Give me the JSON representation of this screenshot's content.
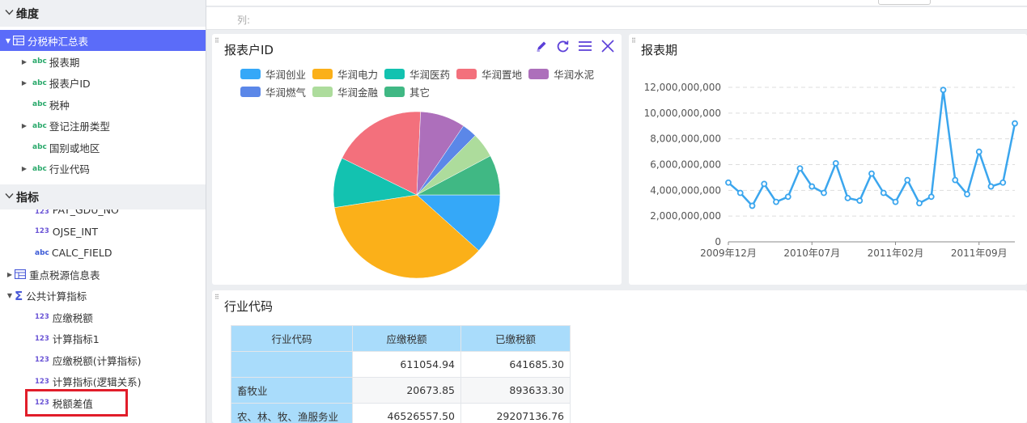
{
  "sidebar": {
    "dimensions_title": "维度",
    "table_name": "分税种汇总表",
    "dimension_fields": [
      {
        "label": "报表期",
        "expandable": true
      },
      {
        "label": "报表户ID",
        "expandable": true
      },
      {
        "label": "税种",
        "expandable": false
      },
      {
        "label": "登记注册类型",
        "expandable": true
      },
      {
        "label": "国别或地区",
        "expandable": false
      },
      {
        "label": "行业代码",
        "expandable": true
      }
    ],
    "metrics_title": "指标",
    "cut_field": "PAY_GDU_NO",
    "metric_fields_a": [
      "OJSE_INT",
      "CALC_FIELD"
    ],
    "table2_name": "重点税源信息表",
    "group_name": "公共计算指标",
    "calc_fields": [
      "应缴税额",
      "计算指标1",
      "应缴税额(计算指标)",
      "计算指标(逻辑关系)",
      "税额差值"
    ],
    "type_abc": "abc",
    "type_num": "123"
  },
  "colbar_label": "列:",
  "pie_panel": {
    "title": "报表户ID",
    "tools": [
      "edit-icon",
      "refresh-icon",
      "menu-icon",
      "close-icon"
    ]
  },
  "line_panel": {
    "title": "报表期"
  },
  "table_panel": {
    "title": "行业代码",
    "headers": [
      "行业代码",
      "应缴税额",
      "已缴税额"
    ],
    "rows": [
      [
        "",
        "611054.94",
        "641685.30"
      ],
      [
        "畜牧业",
        "20673.85",
        "893633.30"
      ],
      [
        "农、林、牧、渔服务业",
        "46526557.50",
        "29207136.76"
      ]
    ]
  },
  "chart_data": [
    {
      "type": "pie",
      "title": "报表户ID",
      "labels": [
        "华润创业",
        "华润电力",
        "华润医药",
        "华润置地",
        "华润水泥",
        "华润燃气",
        "华润金融",
        "其它"
      ],
      "colors": [
        "#35a8f8",
        "#fbb019",
        "#13c2b0",
        "#f3707c",
        "#ad6fbb",
        "#5b87e8",
        "#addc9c",
        "#40b884"
      ],
      "values": [
        12,
        37,
        10,
        19,
        9,
        3,
        5,
        8
      ]
    },
    {
      "type": "line",
      "title": "报表期",
      "color": "#3ba6ee",
      "y_ticks": [
        "0",
        "2,000,000,000",
        "4,000,000,000",
        "6,000,000,000",
        "8,000,000,000",
        "10,000,000,000",
        "12,000,000,000"
      ],
      "ylim": [
        0,
        12000000000
      ],
      "x_ticks": [
        "2009年12月",
        "2010年07月",
        "2011年02月",
        "2011年09月"
      ],
      "x_tick_index": [
        0,
        7,
        14,
        21
      ],
      "values": [
        4600000000,
        3800000000,
        2800000000,
        4500000000,
        3100000000,
        3500000000,
        5700000000,
        4300000000,
        3800000000,
        6100000000,
        3400000000,
        3200000000,
        5300000000,
        3800000000,
        3100000000,
        4800000000,
        3000000000,
        3500000000,
        11800000000,
        4800000000,
        3700000000,
        7000000000,
        4300000000,
        4600000000,
        9200000000
      ]
    }
  ]
}
